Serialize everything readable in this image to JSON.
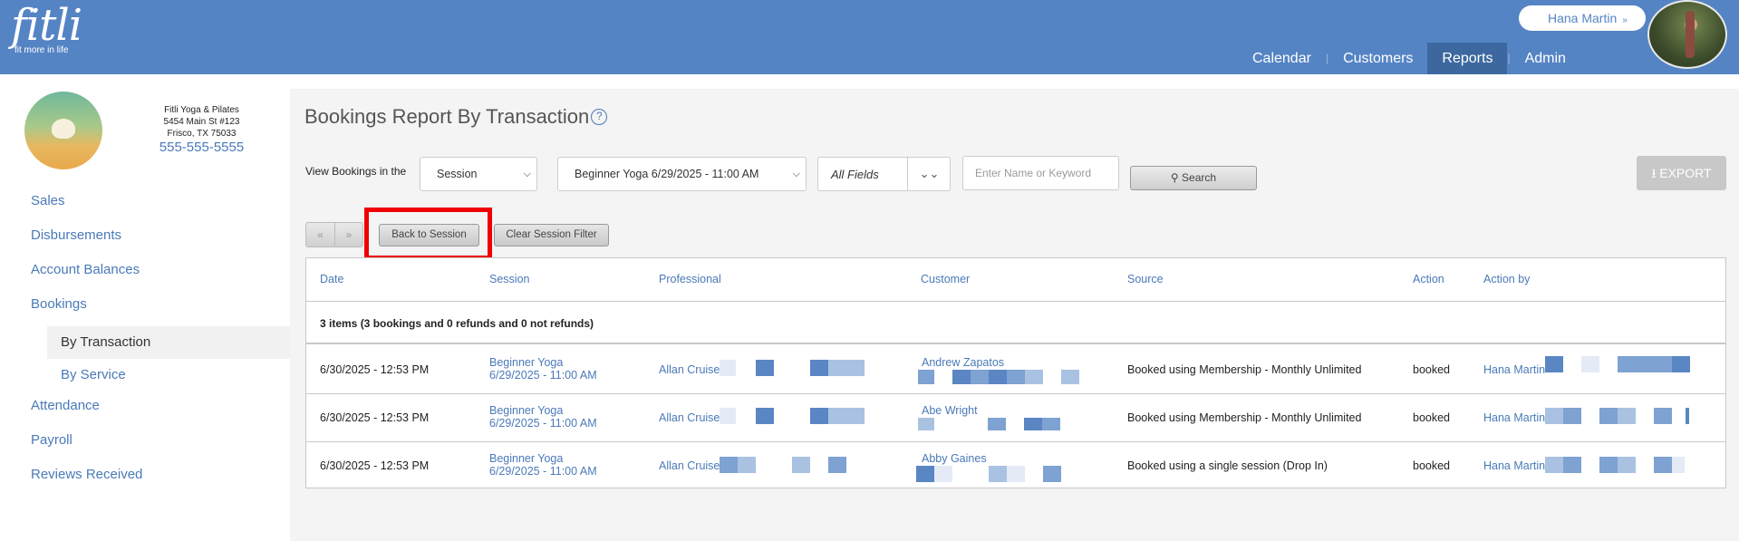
{
  "header": {
    "logo_text": "fitli",
    "logo_tagline": "fit more in life",
    "user_name": "Hana Martin",
    "user_chevron": "»",
    "nav": [
      {
        "label": "Calendar",
        "active": false
      },
      {
        "label": "Customers",
        "active": false
      },
      {
        "label": "Reports",
        "active": true
      },
      {
        "label": "Admin",
        "active": false
      }
    ]
  },
  "business": {
    "name": "Fitli Yoga & Pilates",
    "address1": "5454 Main St #123",
    "address2": "Frisco, TX 75033",
    "phone": "555-555-5555"
  },
  "sidebar": {
    "items": [
      {
        "label": "Sales"
      },
      {
        "label": "Disbursements"
      },
      {
        "label": "Account Balances"
      },
      {
        "label": "Bookings"
      }
    ],
    "bookings_sub": [
      {
        "label": "By Transaction",
        "active": true
      },
      {
        "label": "By Service",
        "active": false
      }
    ],
    "items_after": [
      {
        "label": "Attendance"
      },
      {
        "label": "Payroll"
      },
      {
        "label": "Reviews Received"
      }
    ]
  },
  "page": {
    "title": "Bookings Report By Transaction",
    "help_icon": "?",
    "filter_label": "View Bookings in the",
    "scope_select": "Session",
    "session_select": "Beginner Yoga 6/29/2025 - 11:00 AM",
    "fields_select": "All Fields",
    "keyword_placeholder": "Enter Name or Keyword",
    "search_label": "Search",
    "export_label": "EXPORT",
    "pager_prev": "«",
    "pager_next": "»",
    "back_label": "Back to Session",
    "clear_label": "Clear Session Filter"
  },
  "table": {
    "headers": [
      "Date",
      "Session",
      "Professional",
      "Customer",
      "Source",
      "Action",
      "Action by"
    ],
    "summary": "3 items (3 bookings and 0 refunds and 0 not refunds)",
    "rows": [
      {
        "date": "6/30/2025 - 12:53 PM",
        "session_name": "Beginner Yoga",
        "session_time": "6/29/2025 - 11:00 AM",
        "professional": "Allan Cruise",
        "customer": "Andrew Zapatos",
        "source": "Booked using Membership - Monthly Unlimited",
        "action": "booked",
        "action_by": "Hana Martin"
      },
      {
        "date": "6/30/2025 - 12:53 PM",
        "session_name": "Beginner Yoga",
        "session_time": "6/29/2025 - 11:00 AM",
        "professional": "Allan Cruise",
        "customer": "Abe Wright",
        "source": "Booked using Membership - Monthly Unlimited",
        "action": "booked",
        "action_by": "Hana Martin"
      },
      {
        "date": "6/30/2025 - 12:53 PM",
        "session_name": "Beginner Yoga",
        "session_time": "6/29/2025 - 11:00 AM",
        "professional": "Allan Cruise",
        "customer": "Abby Gaines",
        "source": "Booked using a single session (Drop In)",
        "action": "booked",
        "action_by": "Hana Martin"
      }
    ]
  },
  "colors": {
    "header_bg": "#5584c4",
    "nav_active_bg": "#3d689f",
    "link": "#4a7ab8",
    "highlight_box": "#e00000",
    "content_bg": "#f4f4f4"
  }
}
